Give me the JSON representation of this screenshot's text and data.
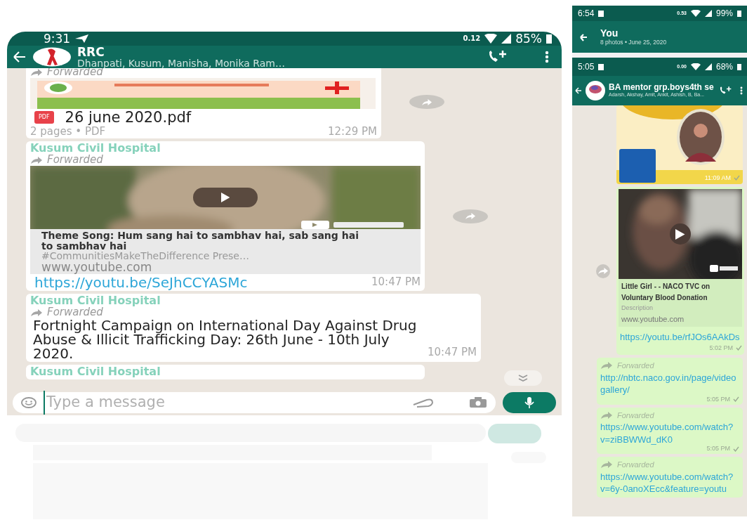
{
  "left_phone": {
    "status_bar": {
      "time": "9:31",
      "net_speed": "0.12",
      "battery": "85%"
    },
    "header": {
      "title": "RRC",
      "subtitle": "Dhanpati, Kusum, Manisha, Monika Ram…"
    },
    "messages": [
      {
        "kind": "document",
        "forward_label": "Forwarded",
        "file_badge": "PDF",
        "file_name": "26 june 2020.pdf",
        "meta": "2 pages • PDF",
        "time": "12:29 PM",
        "forward_button": true
      },
      {
        "kind": "link_preview",
        "sender": "Kusum Civil Hospital",
        "forward_label": "Forwarded",
        "preview_title": "Theme Song: Hum sang hai to sambhav hai, sab sang hai to sambhav hai",
        "preview_description": "#CommunitiesMakeTheDifference Prese…",
        "preview_domain": "www.youtube.com",
        "link": "https://youtu.be/SeJhCCYASMc",
        "time": "10:47 PM",
        "forward_button": true
      },
      {
        "kind": "text",
        "sender": "Kusum Civil Hospital",
        "forward_label": "Forwarded",
        "text": "Fortnight Campaign on International Day Against Drug Abuse & Illicit Trafficking Day: 26th June - 10th July 2020.",
        "time": "10:47 PM",
        "forward_button": false
      },
      {
        "kind": "sender_only",
        "sender": "Kusum Civil Hospital",
        "forward_button": false
      }
    ],
    "input": {
      "placeholder": "Type a message"
    }
  },
  "right_phone": {
    "top_screen": {
      "status_bar": {
        "time": "6:54",
        "net_speed": "0.53",
        "battery": "99%"
      },
      "header": {
        "title": "You",
        "subtitle": "8 photos • June 25, 2020"
      }
    },
    "chat_screen": {
      "status_bar": {
        "time": "5:05",
        "net_speed": "0.00",
        "battery": "68%"
      },
      "header": {
        "title": "BA mentor grp.boys4th se",
        "subtitle": "Adarsh, Akshay, Amit, Ankit, Ashish, B, Ba..."
      },
      "messages": [
        {
          "time": "11:09 AM",
          "forward_button": false
        },
        {
          "kind": "link_preview",
          "preview_title": "Little Girl - - NACO TVC on Voluntary Blood Donation",
          "preview_description": "Description",
          "preview_domain": "www.youtube.com",
          "link": "https://youtu.be/rfJOs6AAkDs",
          "time": "5:02 PM",
          "forward_button": true
        },
        {
          "kind": "link",
          "forward_label": "Forwarded",
          "link": "http://nbtc.naco.gov.in/page/videogallery/",
          "time": "5:05 PM",
          "forward_button": false
        },
        {
          "kind": "link",
          "forward_label": "Forwarded",
          "link": "https://www.youtube.com/watch?v=ziBBWWd_dK0",
          "time": "5:05 PM",
          "forward_button": false
        },
        {
          "kind": "link",
          "forward_label": "Forwarded",
          "link": "https://www.youtube.com/watch?v=6y-0anoXEcc&feature=youtu",
          "forward_button": false
        }
      ]
    }
  }
}
